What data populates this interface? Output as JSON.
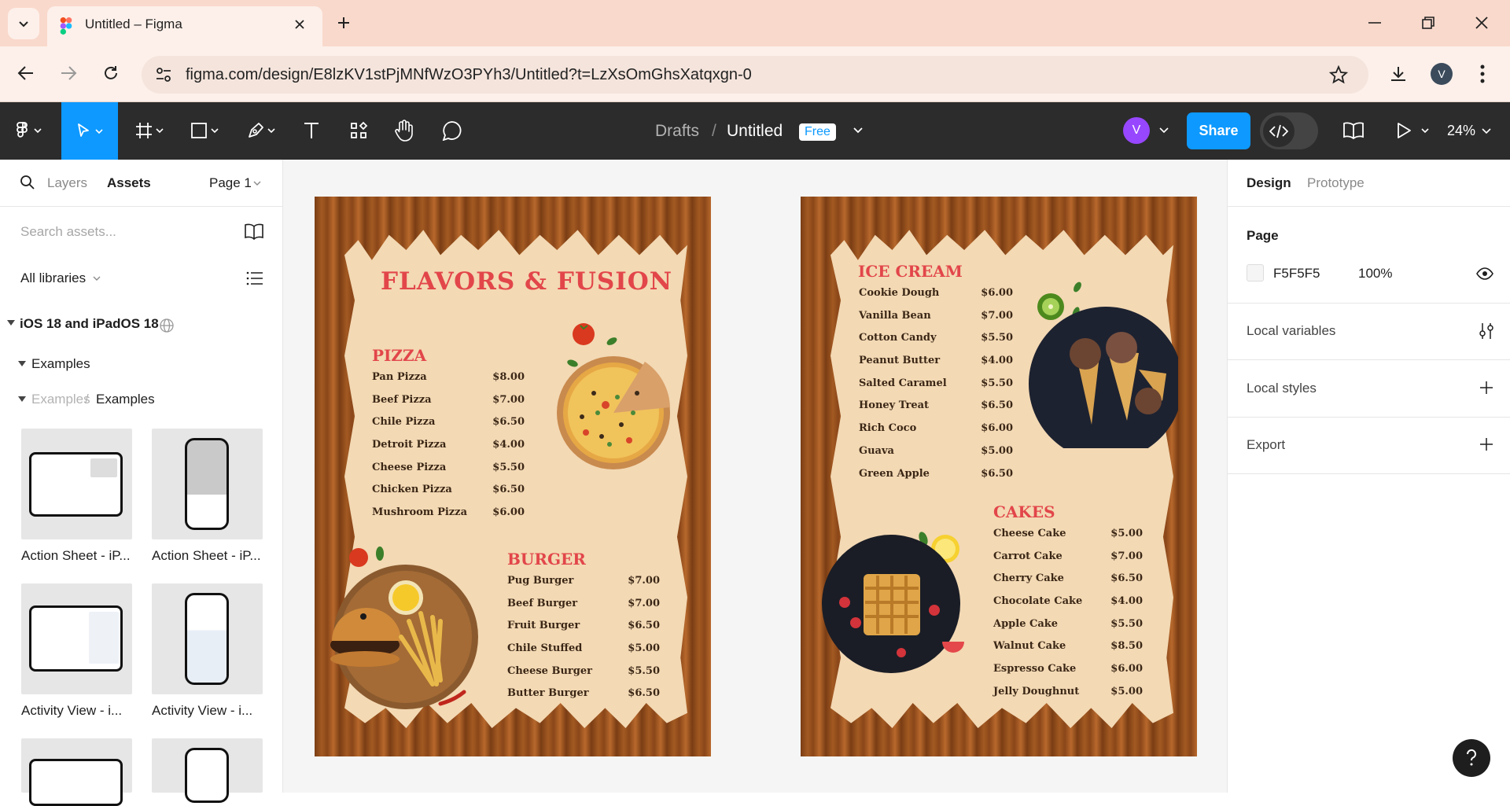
{
  "browser": {
    "tab_title": "Untitled – Figma",
    "url": "figma.com/design/E8lzKV1stPjMNfWzO3PYh3/Untitled?t=LzXsOmGhsXatqxgn-0",
    "profile_initial": "V"
  },
  "toolbar": {
    "breadcrumb_parent": "Drafts",
    "breadcrumb_sep": "/",
    "file_name": "Untitled",
    "plan_badge": "Free",
    "avatar_initial": "V",
    "share_label": "Share",
    "zoom": "24%"
  },
  "left_panel": {
    "tab_layers": "Layers",
    "tab_assets": "Assets",
    "page_select": "Page 1",
    "search_placeholder": "Search assets...",
    "libraries_select": "All libraries",
    "library_name": "iOS 18 and iPadOS 18",
    "group": "Examples",
    "sub_group_parent": "Examples",
    "sub_group_sep": "/",
    "sub_group": "Examples",
    "assets": [
      {
        "label": "Action Sheet - iP..."
      },
      {
        "label": "Action Sheet - iP..."
      },
      {
        "label": "Activity View - i..."
      },
      {
        "label": "Activity View - i..."
      }
    ]
  },
  "right_panel": {
    "tab_design": "Design",
    "tab_prototype": "Prototype",
    "page_heading": "Page",
    "page_color": "F5F5F5",
    "page_opacity": "100%",
    "local_variables": "Local variables",
    "local_styles": "Local styles",
    "export": "Export"
  },
  "menu1": {
    "title": "FLAVORS & FUSION",
    "pizza": {
      "heading": "PIZZA",
      "items": [
        {
          "name": "Pan Pizza",
          "price": "$8.00"
        },
        {
          "name": "Beef Pizza",
          "price": "$7.00"
        },
        {
          "name": "Chile Pizza",
          "price": "$6.50"
        },
        {
          "name": "Detroit Pizza",
          "price": "$4.00"
        },
        {
          "name": "Cheese Pizza",
          "price": "$5.50"
        },
        {
          "name": "Chicken Pizza",
          "price": "$6.50"
        },
        {
          "name": "Mushroom Pizza",
          "price": "$6.00"
        }
      ]
    },
    "burger": {
      "heading": "BURGER",
      "items": [
        {
          "name": "Pug Burger",
          "price": "$7.00"
        },
        {
          "name": "Beef Burger",
          "price": "$7.00"
        },
        {
          "name": "Fruit Burger",
          "price": "$6.50"
        },
        {
          "name": "Chile Stuffed",
          "price": "$5.00"
        },
        {
          "name": "Cheese Burger",
          "price": "$5.50"
        },
        {
          "name": "Butter Burger",
          "price": "$6.50"
        }
      ]
    }
  },
  "menu2": {
    "icecream": {
      "heading": "ICE CREAM",
      "items": [
        {
          "name": "Cookie Dough",
          "price": "$6.00"
        },
        {
          "name": "Vanilla Bean",
          "price": "$7.00"
        },
        {
          "name": "Cotton Candy",
          "price": "$5.50"
        },
        {
          "name": "Peanut Butter",
          "price": "$4.00"
        },
        {
          "name": "Salted Caramel",
          "price": "$5.50"
        },
        {
          "name": "Honey Treat",
          "price": "$6.50"
        },
        {
          "name": "Rich Coco",
          "price": "$6.00"
        },
        {
          "name": "Guava",
          "price": "$5.00"
        },
        {
          "name": "Green Apple",
          "price": "$6.50"
        }
      ]
    },
    "cakes": {
      "heading": "CAKES",
      "items": [
        {
          "name": "Cheese Cake",
          "price": "$5.00"
        },
        {
          "name": "Carrot Cake",
          "price": "$7.00"
        },
        {
          "name": "Cherry Cake",
          "price": "$6.50"
        },
        {
          "name": "Chocolate Cake",
          "price": "$4.00"
        },
        {
          "name": "Apple Cake",
          "price": "$5.50"
        },
        {
          "name": "Walnut Cake",
          "price": "$8.50"
        },
        {
          "name": "Espresso Cake",
          "price": "$6.00"
        },
        {
          "name": "Jelly Doughnut",
          "price": "$5.00"
        }
      ]
    }
  },
  "colors": {
    "brand": "#0d99ff",
    "menu_heading": "#e2464a",
    "toolbar": "#2c2c2c",
    "tabstrip": "#f9d9cc"
  }
}
